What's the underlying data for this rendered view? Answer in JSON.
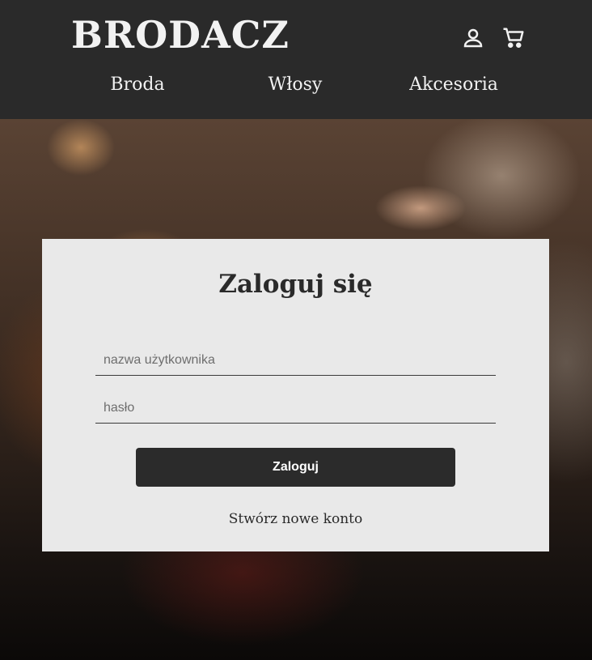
{
  "header": {
    "brand": "BRODACZ",
    "icons": {
      "account": "account-icon",
      "cart": "cart-icon"
    },
    "nav": [
      {
        "label": "Broda"
      },
      {
        "label": "Włosy"
      },
      {
        "label": "Akcesoria"
      }
    ]
  },
  "login": {
    "title": "Zaloguj się",
    "username_placeholder": "nazwa użytkownika",
    "password_placeholder": "hasło",
    "submit_label": "Zaloguj",
    "create_account_label": "Stwórz nowe konto"
  },
  "colors": {
    "header_bg": "#2a2a2a",
    "card_bg": "#e9e9e9",
    "button_bg": "#2b2b2b",
    "text_light": "#f2f2f2"
  }
}
